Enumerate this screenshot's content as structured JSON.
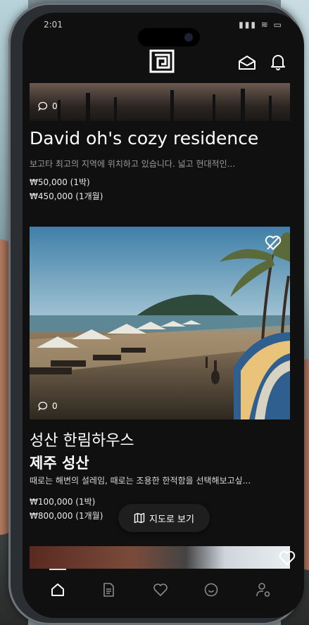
{
  "status": {
    "time": "2:01",
    "indicators": "▮▮▮ ≋ ▭"
  },
  "header": {
    "logo_icon": "maze-logo",
    "icons": [
      "mail-icon",
      "bell-icon"
    ]
  },
  "listings": [
    {
      "comments": "0",
      "title": "David oh's cozy residence",
      "description": "보고타 최고의 지역에 위치하고 있습니다. 넓고 현대적인...",
      "price_night": "₩50,000 (1박)",
      "price_month": "₩450,000 (1개월)"
    },
    {
      "comments": "0",
      "title_line1": "성산 한림하우스",
      "title_line2": "제주 성산",
      "description": "때로는 해변의 설레임, 때로는 조용한 한적함을 선택해보고싶...",
      "price_night": "₩100,000 (1박)",
      "price_month": "₩800,000 (1개월)"
    }
  ],
  "map_button": {
    "label": "지도로 보기"
  },
  "tabbar": {
    "tabs": [
      "home-icon",
      "document-icon",
      "heart-icon",
      "smile-icon",
      "profile-settings-icon"
    ],
    "active": 0
  },
  "colors": {
    "background": "#101010",
    "text": "#ffffff",
    "muted": "#9a9a9a"
  }
}
